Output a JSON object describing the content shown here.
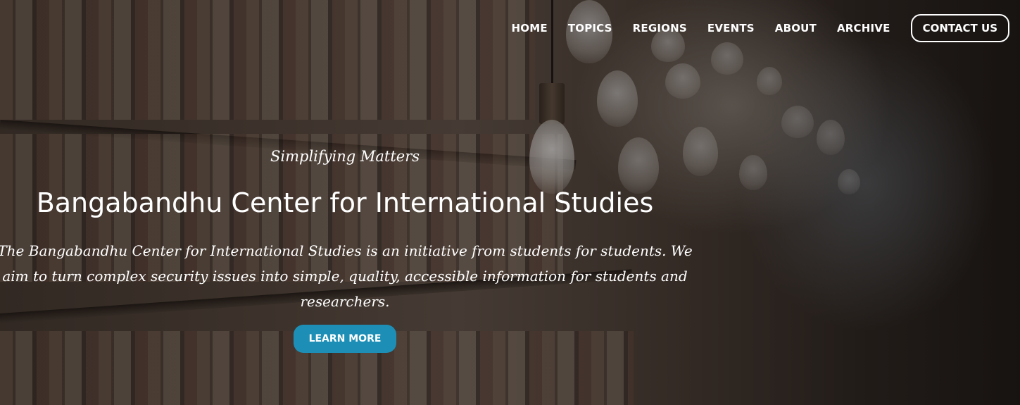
{
  "nav": {
    "items": [
      {
        "label": "HOME"
      },
      {
        "label": "TOPICS"
      },
      {
        "label": "REGIONS"
      },
      {
        "label": "EVENTS"
      },
      {
        "label": "ABOUT"
      },
      {
        "label": "ARCHIVE"
      }
    ],
    "contact_label": "CONTACT US"
  },
  "hero": {
    "tagline": "Simplifying Matters",
    "title": "Bangabandhu Center for International Studies",
    "description": "The Bangabandhu Center for International Studies is an initiative from students for students. We aim to turn complex security issues into simple, quality, accessible information for students and researchers.",
    "cta_label": "LEARN MORE"
  },
  "colors": {
    "accent": "#1d8fb6",
    "text": "#ffffff"
  }
}
